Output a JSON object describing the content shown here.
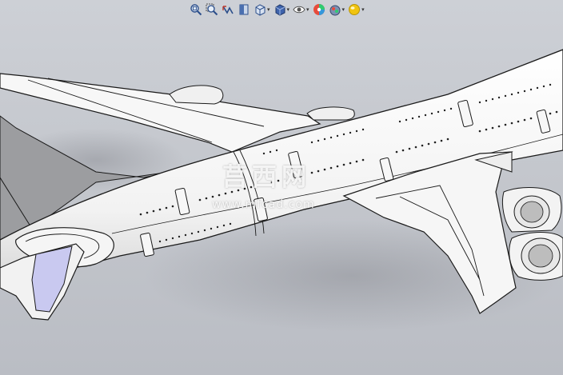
{
  "toolbar": {
    "items": [
      {
        "name": "zoom-to-fit-icon",
        "has_menu": false
      },
      {
        "name": "zoom-to-area-icon",
        "has_menu": false
      },
      {
        "name": "previous-view-icon",
        "has_menu": false
      },
      {
        "name": "section-view-icon",
        "has_menu": false
      },
      {
        "name": "view-orientation-icon",
        "has_menu": true
      },
      {
        "name": "display-style-icon",
        "has_menu": true
      },
      {
        "name": "hide-show-items-icon",
        "has_menu": true
      },
      {
        "name": "edit-appearance-icon",
        "has_menu": false
      },
      {
        "name": "apply-scene-icon",
        "has_menu": true
      },
      {
        "name": "view-settings-icon",
        "has_menu": true
      }
    ],
    "caret": "▾"
  },
  "watermark": {
    "chinese": "莒西网",
    "url": "www.mfcad.com"
  },
  "colors": {
    "viewport_top": "#cdd0d6",
    "viewport_bottom": "#babdc4",
    "model_body": "#f4f4f4",
    "edge": "#1a1a1a",
    "tail_fin": "#9a9a9c",
    "window_glass": "#c9c9f0"
  }
}
